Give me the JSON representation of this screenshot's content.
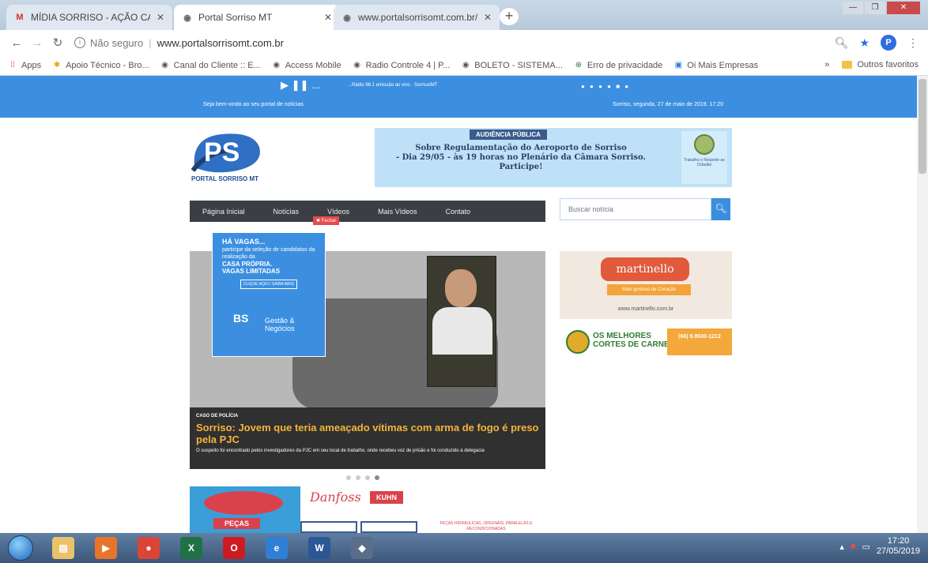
{
  "browser": {
    "tabs": [
      {
        "label": "MÍDIA SORRISO - AÇÃO CARRE",
        "active": false,
        "icon": "gmail-icon"
      },
      {
        "label": "Portal Sorriso MT",
        "active": true,
        "icon": "globe-icon"
      },
      {
        "label": "www.portalsorrisomt.com.br/ad",
        "active": false,
        "icon": "globe-icon"
      }
    ],
    "new_tab": "+",
    "security": "Não seguro",
    "url": "www.portalsorrisomt.com.br",
    "bookmarks": [
      {
        "label": "Apps",
        "icon": "apps-grid-icon"
      },
      {
        "label": "Apoio Técnico - Bro...",
        "icon": "star-icon"
      },
      {
        "label": "Canal do Cliente :: E...",
        "icon": "globe-icon"
      },
      {
        "label": "Access Mobile",
        "icon": "globe-icon"
      },
      {
        "label": "Radio Controle 4 | P...",
        "icon": "globe-icon"
      },
      {
        "label": "BOLETO - SISTEMA...",
        "icon": "globe-icon"
      },
      {
        "label": "Erro de privacidade",
        "icon": "warning-icon"
      },
      {
        "label": "Oi Mais Empresas",
        "icon": "oi-icon"
      }
    ],
    "bookmarks_overflow": "»",
    "other_bookmarks": "Outros favoritos",
    "profile_initial": "P"
  },
  "site": {
    "welcome": "Seja bem-vindo ao seu portal de notícias",
    "date": "Sorriso, segunda, 27 de maio de 2019. 17:20",
    "player": "▶ ❚❚ ...",
    "radio_text": "...Rádio 98.1 emissão ao vivo · Sorriso/MT",
    "logo_text": "PORTAL SORRISO MT",
    "banner": {
      "tag": "AUDIÊNCIA PÚBLICA",
      "line1": "Sobre Regulamentação do Aeroporto de Sorriso",
      "line2": "- Dia 29/05 - às 19 horas no Plenário da Câmara Sorriso.",
      "line3": "Participe!",
      "seal_caption": "Trabalho e Respeito ao Cidadão"
    },
    "menu": [
      "Página Inicial",
      "Notícias",
      "Vídeos",
      "Mais Vídeos",
      "Contato"
    ],
    "fechar": "✖ Fechar",
    "search_placeholder": "Buscar notícia",
    "popup": {
      "title": "HÁ VAGAS...",
      "body": "participe da seleção de candidatos da realização da",
      "bold1": "CASA PRÓPRIA.",
      "bold2": "VAGAS LIMITADAS",
      "button": "CLIQUE AQUI / SAIBA MAIS",
      "brand1": "BS",
      "brand2": "Gestão & Negócios"
    },
    "slide": {
      "category": "CASO DE POLÍCIA",
      "headline": "Sorriso: Jovem que teria ameaçado vítimas com arma de fogo é preso pela PJC",
      "summary": "O suspeito foi encontrado pelos investigadores da PJC em seu local de trabalho, onde recebeu voz de prisão e foi conduzido à delegacia"
    },
    "ad_martinello": {
      "name": "martinello",
      "slogan": "Mais gostoso de Coração",
      "site": "www.martinello.com.br"
    },
    "ad_meat": {
      "title1": "OS MELHORES",
      "title2": "CORTES DE CARNES",
      "phone": "(66) 9.9630-1212"
    },
    "bottom_ad": {
      "pecas": "PEÇAS",
      "danfoss": "Danfoss",
      "kuhn": "KUHN",
      "caption": "PEÇAS HIDRÁULICAS, ORIGINAIS, PARALELAS E RECONDICIONADAS"
    }
  },
  "taskbar": {
    "apps": [
      {
        "name": "file-explorer-icon",
        "color": "#e9c36a",
        "glyph": "▤"
      },
      {
        "name": "media-player-icon",
        "color": "#e8742a",
        "glyph": "▶"
      },
      {
        "name": "chrome-icon",
        "color": "#db4437",
        "glyph": "●"
      },
      {
        "name": "excel-icon",
        "color": "#1f7244",
        "glyph": "X"
      },
      {
        "name": "opera-icon",
        "color": "#cc1b24",
        "glyph": "O"
      },
      {
        "name": "ie-icon",
        "color": "#2f7fd6",
        "glyph": "e"
      },
      {
        "name": "word-icon",
        "color": "#2b5797",
        "glyph": "W"
      },
      {
        "name": "app-icon",
        "color": "#5a6e8a",
        "glyph": "◆"
      }
    ],
    "time": "17:20",
    "date": "27/05/2019"
  }
}
